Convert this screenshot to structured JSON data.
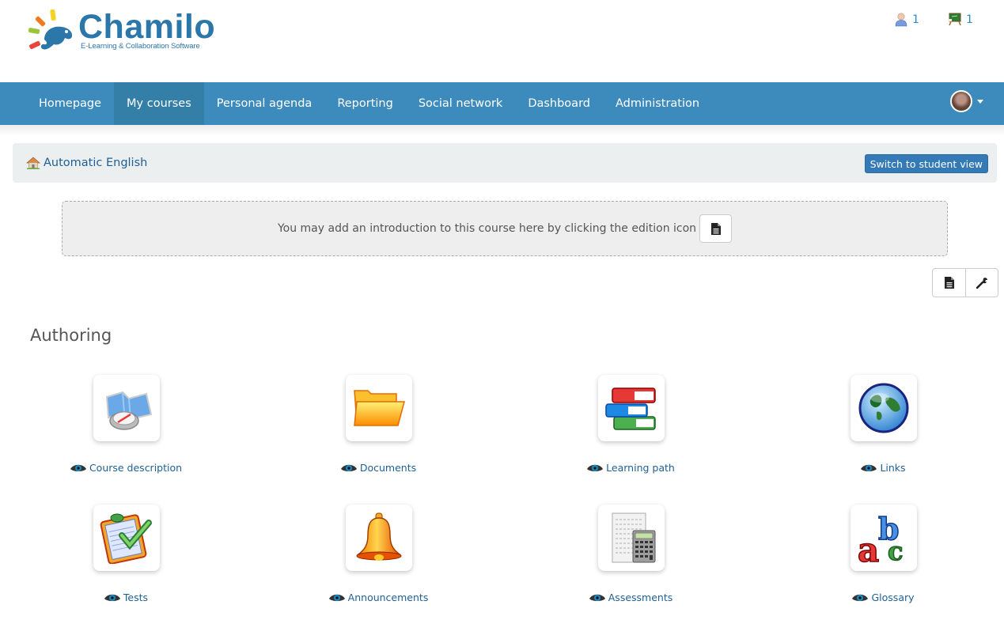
{
  "header": {
    "logo_title": "Chamilo",
    "logo_subtitle": "E-Learning & Collaboration Software",
    "online_users_count": "1",
    "online_courses_count": "1"
  },
  "navbar": {
    "items": [
      {
        "label": "Homepage",
        "active": false
      },
      {
        "label": "My courses",
        "active": true
      },
      {
        "label": "Personal agenda",
        "active": false
      },
      {
        "label": "Reporting",
        "active": false
      },
      {
        "label": "Social network",
        "active": false
      },
      {
        "label": "Dashboard",
        "active": false
      },
      {
        "label": "Administration",
        "active": false
      }
    ],
    "color": "#3d8bbd",
    "active_color": "#347fa8"
  },
  "breadcrumb": {
    "course_name": "Automatic English",
    "switch_view_label": "Switch to student view"
  },
  "intro": {
    "message": "You may add an introduction to this course here by clicking the edition icon"
  },
  "section": {
    "title": "Authoring",
    "tools": [
      {
        "label": "Course description",
        "icon": "compass-map-icon"
      },
      {
        "label": "Documents",
        "icon": "folder-icon"
      },
      {
        "label": "Learning path",
        "icon": "books-icon"
      },
      {
        "label": "Links",
        "icon": "globe-icon"
      },
      {
        "label": "Tests",
        "icon": "quiz-checklist-icon"
      },
      {
        "label": "Announcements",
        "icon": "bell-icon"
      },
      {
        "label": "Assessments",
        "icon": "calculator-sheet-icon"
      },
      {
        "label": "Glossary",
        "icon": "abc-icon"
      }
    ]
  }
}
